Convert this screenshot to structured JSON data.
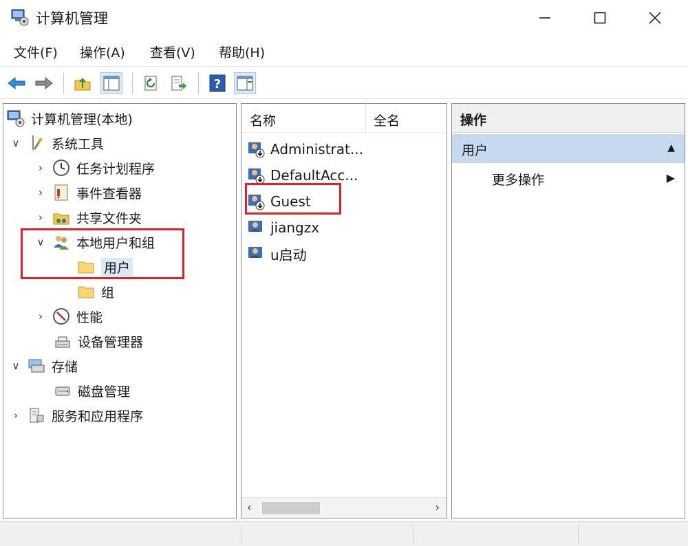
{
  "window": {
    "title": "计算机管理"
  },
  "menu": [
    {
      "label": "文件(F)"
    },
    {
      "label": "操作(A)"
    },
    {
      "label": "查看(V)"
    },
    {
      "label": "帮助(H)"
    }
  ],
  "toolbar": {
    "buttons": [
      "back-icon",
      "forward-icon",
      "up-folder-icon",
      "show-hide-tree-icon",
      "refresh-icon",
      "export-list-icon",
      "help-icon",
      "show-hide-action-pane-icon"
    ]
  },
  "tree": {
    "items": [
      {
        "label": "计算机管理(本地)",
        "icon": "computer-management-icon"
      },
      {
        "label": "系统工具",
        "icon": "tools-icon",
        "expanded": true
      },
      {
        "label": "任务计划程序",
        "icon": "clock-icon"
      },
      {
        "label": "事件查看器",
        "icon": "event-viewer-icon"
      },
      {
        "label": "共享文件夹",
        "icon": "shared-folder-icon"
      },
      {
        "label": "本地用户和组",
        "icon": "users-group-icon",
        "expanded": true
      },
      {
        "label": "用户",
        "icon": "folder-icon",
        "selected": true
      },
      {
        "label": "组",
        "icon": "folder-icon"
      },
      {
        "label": "性能",
        "icon": "performance-icon"
      },
      {
        "label": "设备管理器",
        "icon": "device-manager-icon"
      },
      {
        "label": "存储",
        "icon": "storage-icon",
        "expanded": true
      },
      {
        "label": "磁盘管理",
        "icon": "disk-icon"
      },
      {
        "label": "服务和应用程序",
        "icon": "services-icon"
      }
    ]
  },
  "list": {
    "columns": [
      "名称",
      "全名"
    ],
    "rows": [
      {
        "name": "Administrat...",
        "disabled": true
      },
      {
        "name": "DefaultAcc...",
        "disabled": true
      },
      {
        "name": "Guest",
        "disabled": true
      },
      {
        "name": "jiangzx",
        "disabled": false
      },
      {
        "name": "u启动",
        "disabled": false
      }
    ]
  },
  "actions": {
    "title": "操作",
    "section": "用户",
    "items": [
      {
        "label": "更多操作"
      }
    ]
  },
  "colors": {
    "highlight": "#e0202b",
    "selection": "#dbe8f6",
    "section_bg": "#c6d9ef"
  }
}
